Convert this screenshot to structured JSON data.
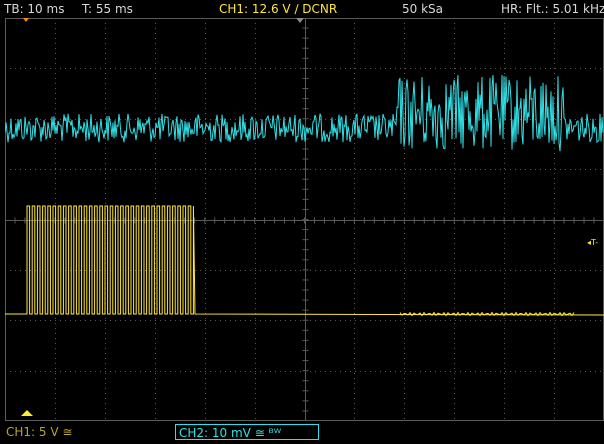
{
  "header": {
    "timebase": "TB: 10 ms",
    "trigger_time": "T: 55 ms",
    "ch1_trigger": "CH1: 12.6 V ∕ DCNR",
    "sample_rate": "50 kSa",
    "hr_filter": "HR: Flt.: 5.01 kHz"
  },
  "footer": {
    "ch1_scale": "CH1: 5 V ≅",
    "ch2_scale": "CH2: 10 mV ≅ ᴮᵂ"
  },
  "markers": {
    "trigger_level": "◂T-"
  },
  "colors": {
    "ch1": "#ffe838",
    "ch2": "#2fe0e6",
    "grid": "#5a5a5a",
    "text": "#d8d8d8"
  },
  "icons": {
    "trigger_position": "yellow-triangle-up-icon",
    "top_trigger_marker": "orange-triangle-down-icon"
  }
}
